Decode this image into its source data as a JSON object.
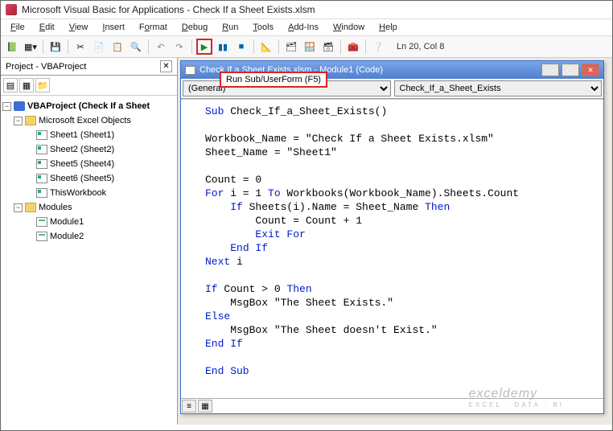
{
  "title": "Microsoft Visual Basic for Applications - Check If a Sheet Exists.xlsm",
  "menus": [
    "File",
    "Edit",
    "View",
    "Insert",
    "Format",
    "Debug",
    "Run",
    "Tools",
    "Add-Ins",
    "Window",
    "Help"
  ],
  "tooltip": "Run Sub/UserForm (F5)",
  "status": "Ln 20, Col 8",
  "project_panel_title": "Project - VBAProject",
  "tree": {
    "root": "VBAProject (Check If a Sheet",
    "excel_objects": "Microsoft Excel Objects",
    "sheets": [
      "Sheet1 (Sheet1)",
      "Sheet2 (Sheet2)",
      "Sheet5 (Sheet4)",
      "Sheet6 (Sheet5)",
      "ThisWorkbook"
    ],
    "modules_folder": "Modules",
    "modules": [
      "Module1",
      "Module2"
    ]
  },
  "code_window": {
    "title": "Check If a Sheet Exists.xlsm - Module1 (Code)",
    "left_select": "(General)",
    "right_select": "Check_If_a_Sheet_Exists"
  },
  "code_lines": {
    "l1a": "Sub",
    "l1b": " Check_If_a_Sheet_Exists()",
    "l3": "Workbook_Name = \"Check If a Sheet Exists.xlsm\"",
    "l4": "Sheet_Name = \"Sheet1\"",
    "l6": "Count = 0",
    "l7a": "For",
    "l7b": " i = 1 ",
    "l7c": "To",
    "l7d": " Workbooks(Workbook_Name).Sheets.Count",
    "l8a": "    ",
    "l8b": "If",
    "l8c": " Sheets(i).Name = Sheet_Name ",
    "l8d": "Then",
    "l9": "        Count = Count + 1",
    "l10a": "        ",
    "l10b": "Exit For",
    "l11a": "    ",
    "l11b": "End If",
    "l12a": "Next",
    "l12b": " i",
    "l14a": "If",
    "l14b": " Count > 0 ",
    "l14c": "Then",
    "l15": "    MsgBox \"The Sheet Exists.\"",
    "l16": "Else",
    "l17": "    MsgBox \"The Sheet doesn't Exist.\"",
    "l18": "End If",
    "l20": "End Sub"
  },
  "watermark": "exceldemy",
  "watermark_sub": "EXCEL · DATA · BI"
}
